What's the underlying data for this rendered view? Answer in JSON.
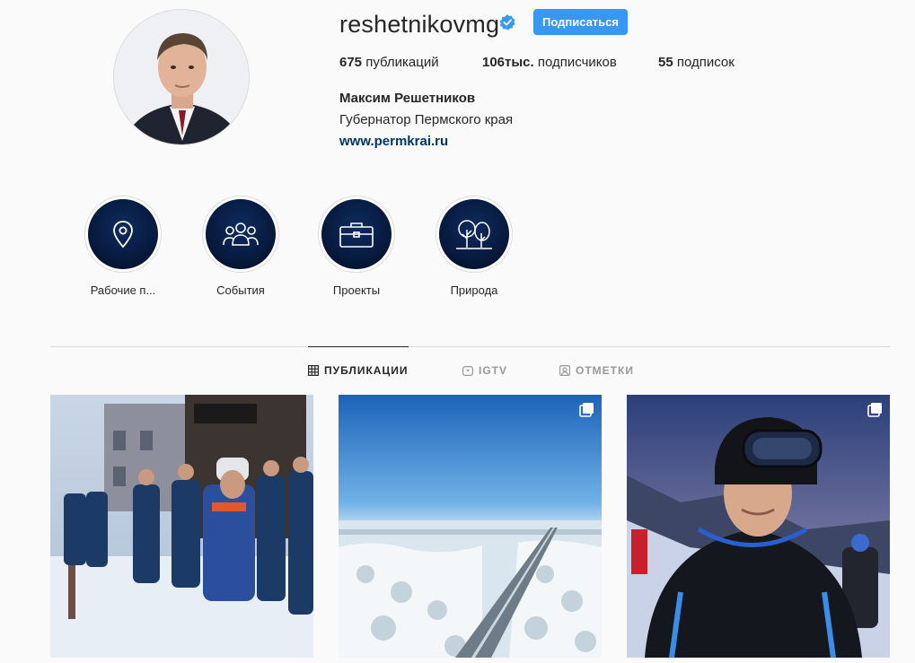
{
  "profile": {
    "username": "reshetnikovmg",
    "follow_label": "Подписаться",
    "stats": {
      "posts_count": "675",
      "posts_label": " публикаций",
      "followers_count": "106тыс.",
      "followers_label": " подписчиков",
      "following_count": "55",
      "following_label": " подписок"
    },
    "full_name": "Максим Решетников",
    "bio": "Губернатор Пермского края",
    "website": "www.permkrai.ru"
  },
  "highlights": [
    {
      "label": "Рабочие п...",
      "icon": "location-pin-icon"
    },
    {
      "label": "События",
      "icon": "people-icon"
    },
    {
      "label": "Проекты",
      "icon": "briefcase-icon"
    },
    {
      "label": "Природа",
      "icon": "trees-icon"
    }
  ],
  "tabs": [
    {
      "label": "ПУБЛИКАЦИИ",
      "icon": "grid-icon",
      "active": true
    },
    {
      "label": "IGTV",
      "icon": "igtv-icon",
      "active": false
    },
    {
      "label": "ОТМЕТКИ",
      "icon": "tagged-icon",
      "active": false
    }
  ],
  "posts": [
    {
      "subject": "emergency-workers-winter",
      "multi": false
    },
    {
      "subject": "snowy-forest-road",
      "multi": true
    },
    {
      "subject": "skier-portrait",
      "multi": true
    }
  ],
  "colors": {
    "accent": "#3897f0",
    "link": "#003569",
    "highlight_bg": "#071a3e",
    "background": "#fafafa"
  }
}
